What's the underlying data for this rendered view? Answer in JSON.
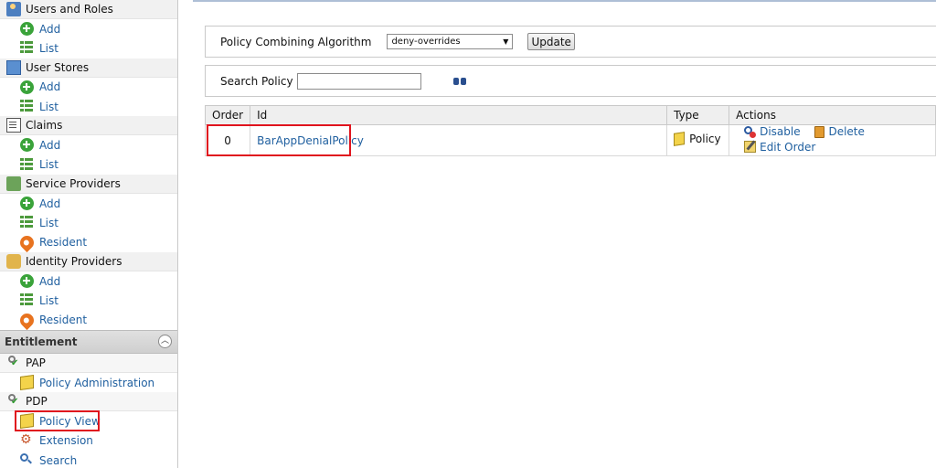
{
  "sidebar": {
    "sections": [
      {
        "label": "Users and Roles",
        "icon": "users-roles-icon",
        "items": [
          {
            "label": "Add",
            "icon": "add-icon"
          },
          {
            "label": "List",
            "icon": "list-icon"
          }
        ]
      },
      {
        "label": "User Stores",
        "icon": "user-stores-icon",
        "items": [
          {
            "label": "Add",
            "icon": "add-icon"
          },
          {
            "label": "List",
            "icon": "list-icon"
          }
        ]
      },
      {
        "label": "Claims",
        "icon": "claims-icon",
        "items": [
          {
            "label": "Add",
            "icon": "add-icon"
          },
          {
            "label": "List",
            "icon": "list-icon"
          }
        ]
      },
      {
        "label": "Service Providers",
        "icon": "service-providers-icon",
        "items": [
          {
            "label": "Add",
            "icon": "add-icon"
          },
          {
            "label": "List",
            "icon": "list-icon"
          },
          {
            "label": "Resident",
            "icon": "resident-icon"
          }
        ]
      },
      {
        "label": "Identity Providers",
        "icon": "identity-providers-icon",
        "items": [
          {
            "label": "Add",
            "icon": "add-icon"
          },
          {
            "label": "List",
            "icon": "list-icon"
          },
          {
            "label": "Resident",
            "icon": "resident-icon"
          }
        ]
      }
    ],
    "entitlement": {
      "label": "Entitlement",
      "pap": {
        "label": "PAP",
        "items": [
          {
            "label": "Policy Administration"
          }
        ]
      },
      "pdp": {
        "label": "PDP",
        "items": [
          {
            "label": "Policy View"
          },
          {
            "label": "Extension"
          },
          {
            "label": "Search"
          }
        ]
      }
    }
  },
  "main": {
    "combining": {
      "label": "Policy Combining Algorithm",
      "selected": "deny-overrides",
      "button": "Update"
    },
    "search": {
      "label": "Search Policy",
      "value": ""
    },
    "table": {
      "headers": [
        "Order",
        "Id",
        "Type",
        "Actions"
      ],
      "rows": [
        {
          "order": "0",
          "id": "BarAppDenialPolicy",
          "type": "Policy",
          "actions": [
            "Disable",
            "Delete",
            "Edit Order"
          ]
        }
      ]
    }
  },
  "colors": {
    "link": "#1f5f9f",
    "highlight": "#e0141e",
    "add_icon": "#3aa33a",
    "resident_icon": "#e8731f"
  }
}
